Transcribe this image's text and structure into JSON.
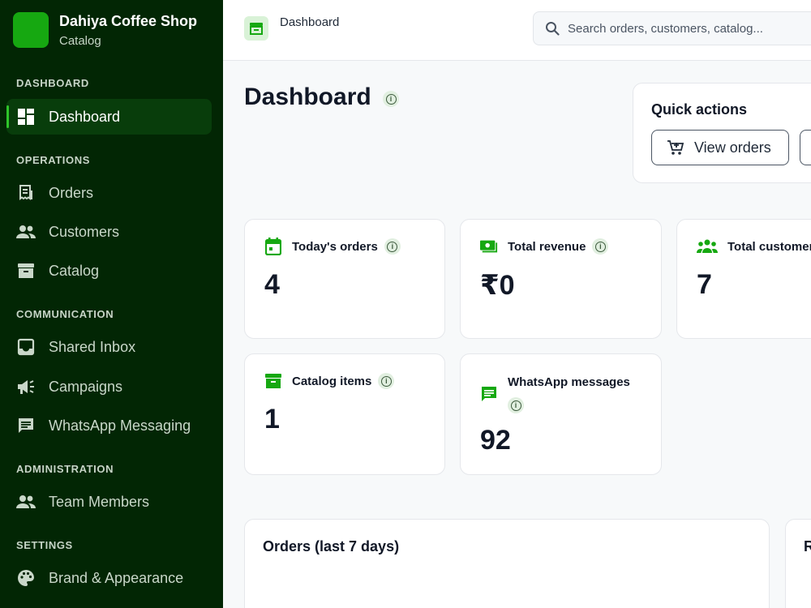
{
  "sidebar": {
    "brand_name": "Dahiya Coffee Shop",
    "brand_sub": "Catalog",
    "sections": {
      "dashboard": "DASHBOARD",
      "operations": "OPERATIONS",
      "communication": "COMMUNICATION",
      "administration": "ADMINISTRATION",
      "settings": "SETTINGS"
    },
    "items": {
      "dashboard": "Dashboard",
      "orders": "Orders",
      "customers": "Customers",
      "catalog": "Catalog",
      "shared_inbox": "Shared Inbox",
      "campaigns": "Campaigns",
      "whatsapp_messaging": "WhatsApp Messaging",
      "team_members": "Team Members",
      "brand_appearance": "Brand & Appearance"
    },
    "active_item": "Dashboard"
  },
  "topbar": {
    "breadcrumb": "Dashboard",
    "search_placeholder": "Search orders, customers, catalog..."
  },
  "main": {
    "title": "Dashboard",
    "quick_actions": {
      "title": "Quick actions",
      "view_orders": "View orders"
    },
    "stats": {
      "todays_orders": {
        "label": "Today's orders",
        "value": "4"
      },
      "total_revenue": {
        "label": "Total revenue",
        "value": "₹0"
      },
      "total_customers": {
        "label": "Total customer",
        "value": "7"
      },
      "catalog_items": {
        "label": "Catalog items",
        "value": "1"
      },
      "whatsapp_messages": {
        "label": "WhatsApp messages",
        "value": "92"
      }
    },
    "panels": {
      "orders_chart_title": "Orders (last 7 days)",
      "right_panel_title": "R"
    }
  },
  "colors": {
    "sidebar_bg": "#022604",
    "active_item_bg": "#083d0b",
    "accent_green": "#16a811",
    "page_bg": "#f7f9fa"
  },
  "icons": {
    "dashboard": "dashboard-grid-icon",
    "orders": "receipt-icon",
    "customers": "people-icon",
    "catalog": "archive-box-icon",
    "shared_inbox": "inbox-icon",
    "campaigns": "megaphone-icon",
    "whatsapp_messaging": "chat-icon",
    "team_members": "people-icon",
    "brand_appearance": "palette-icon",
    "search": "search-icon",
    "cart": "cart-icon",
    "calendar": "calendar-icon",
    "cash": "cash-icon",
    "group": "group-icon"
  }
}
